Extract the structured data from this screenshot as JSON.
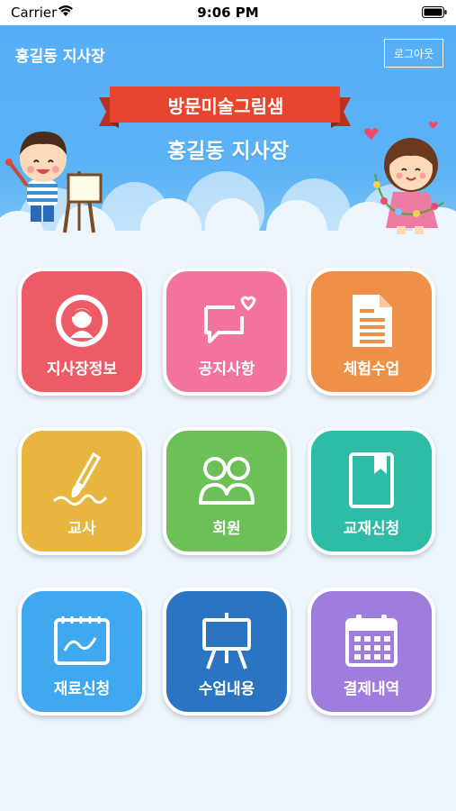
{
  "status_bar": {
    "carrier": "Carrier",
    "time": "9:06 PM"
  },
  "header": {
    "title": "홍길동 지사장",
    "logout_label": "로그아웃",
    "banner_title": "방문미술그림샘",
    "banner_subtitle": "홍길동 지사장"
  },
  "menu": [
    {
      "label": "지사장정보",
      "icon": "branch-logo-icon",
      "color": "#ec5b66"
    },
    {
      "label": "공지사항",
      "icon": "chat-heart-icon",
      "color": "#f2739e"
    },
    {
      "label": "체험수업",
      "icon": "document-icon",
      "color": "#ee9048"
    },
    {
      "label": "교사",
      "icon": "brush-icon",
      "color": "#e8b63e"
    },
    {
      "label": "회원",
      "icon": "members-icon",
      "color": "#6cc057"
    },
    {
      "label": "교재신청",
      "icon": "book-icon",
      "color": "#2ebca7"
    },
    {
      "label": "재료신청",
      "icon": "sketchbook-icon",
      "color": "#3fa8ef"
    },
    {
      "label": "수업내용",
      "icon": "easel-icon",
      "color": "#2b74c1"
    },
    {
      "label": "결제내역",
      "icon": "calendar-icon",
      "color": "#9e7ddd"
    }
  ]
}
